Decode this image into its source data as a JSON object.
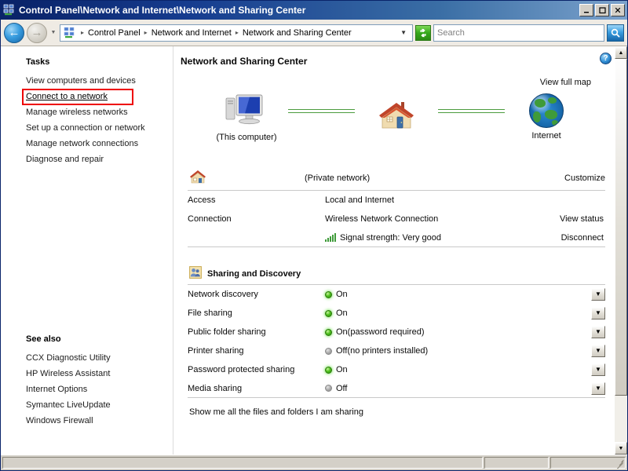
{
  "window": {
    "title": "Control Panel\\Network and Internet\\Network and Sharing Center",
    "icon": "network-folder-icon",
    "minimize_label": "_",
    "maximize_label": "□",
    "close_label": "✕"
  },
  "toolbar": {
    "back_label": "←",
    "forward_label": "→",
    "history_dropdown": "▼",
    "breadcrumbs": [
      "Control Panel",
      "Network and Internet",
      "Network and Sharing Center"
    ],
    "breadcrumb_separator": "▸",
    "address_dropdown": "▼",
    "refresh_label": "↺",
    "search_placeholder": "Search",
    "search_value": "",
    "search_button_label": "⌕"
  },
  "sidebar": {
    "tasks_heading": "Tasks",
    "tasks": [
      {
        "label": "View computers and devices",
        "highlighted": false
      },
      {
        "label": "Connect to a network",
        "highlighted": true
      },
      {
        "label": "Manage wireless networks",
        "highlighted": false
      },
      {
        "label": "Set up a connection or network",
        "highlighted": false
      },
      {
        "label": "Manage network connections",
        "highlighted": false
      },
      {
        "label": "Diagnose and repair",
        "highlighted": false
      }
    ],
    "see_also_heading": "See also",
    "see_also": [
      {
        "label": "CCX Diagnostic Utility"
      },
      {
        "label": "HP Wireless Assistant"
      },
      {
        "label": "Internet Options"
      },
      {
        "label": "Symantec LiveUpdate"
      },
      {
        "label": "Windows Firewall"
      }
    ],
    "highlight_color": "#ee0000"
  },
  "content": {
    "page_title": "Network and Sharing Center",
    "help_label": "?",
    "map": {
      "view_full_map": "View full map",
      "nodes": [
        {
          "icon": "computer-icon",
          "label": "(This computer)"
        },
        {
          "icon": "house-icon",
          "label": ""
        },
        {
          "icon": "globe-icon",
          "label": "Internet"
        }
      ],
      "link_color": "#4d9c3f"
    },
    "network": {
      "icon": "house-icon",
      "name": "(Private network)",
      "customize_label": "Customize",
      "rows": [
        {
          "label": "Access",
          "value": "Local and Internet",
          "action": ""
        },
        {
          "label": "Connection",
          "value": "Wireless Network Connection",
          "action": "View status"
        },
        {
          "label": "",
          "value": "Signal strength:  Very good",
          "action": "Disconnect",
          "icon": "signal-strength-icon"
        }
      ]
    },
    "sharing": {
      "icon": "sharing-users-icon",
      "heading": "Sharing and Discovery",
      "rows": [
        {
          "label": "Network discovery",
          "state": "on",
          "value": "On",
          "expand": "▼"
        },
        {
          "label": "File sharing",
          "state": "on",
          "value": "On",
          "expand": "▼"
        },
        {
          "label": "Public folder sharing",
          "state": "on",
          "value": "On(password required)",
          "expand": "▼"
        },
        {
          "label": "Printer sharing",
          "state": "off",
          "value": "Off(no printers installed)",
          "expand": "▼"
        },
        {
          "label": "Password protected sharing",
          "state": "on",
          "value": "On",
          "expand": "▼"
        },
        {
          "label": "Media sharing",
          "state": "off",
          "value": "Off",
          "expand": "▼"
        }
      ],
      "footer_link": "Show me all the files and folders I am sharing"
    },
    "scrollbar": {
      "up_label": "▲",
      "down_label": "▼"
    }
  },
  "statusbar": {
    "panel1": "",
    "panel2": "",
    "panel3": ""
  }
}
